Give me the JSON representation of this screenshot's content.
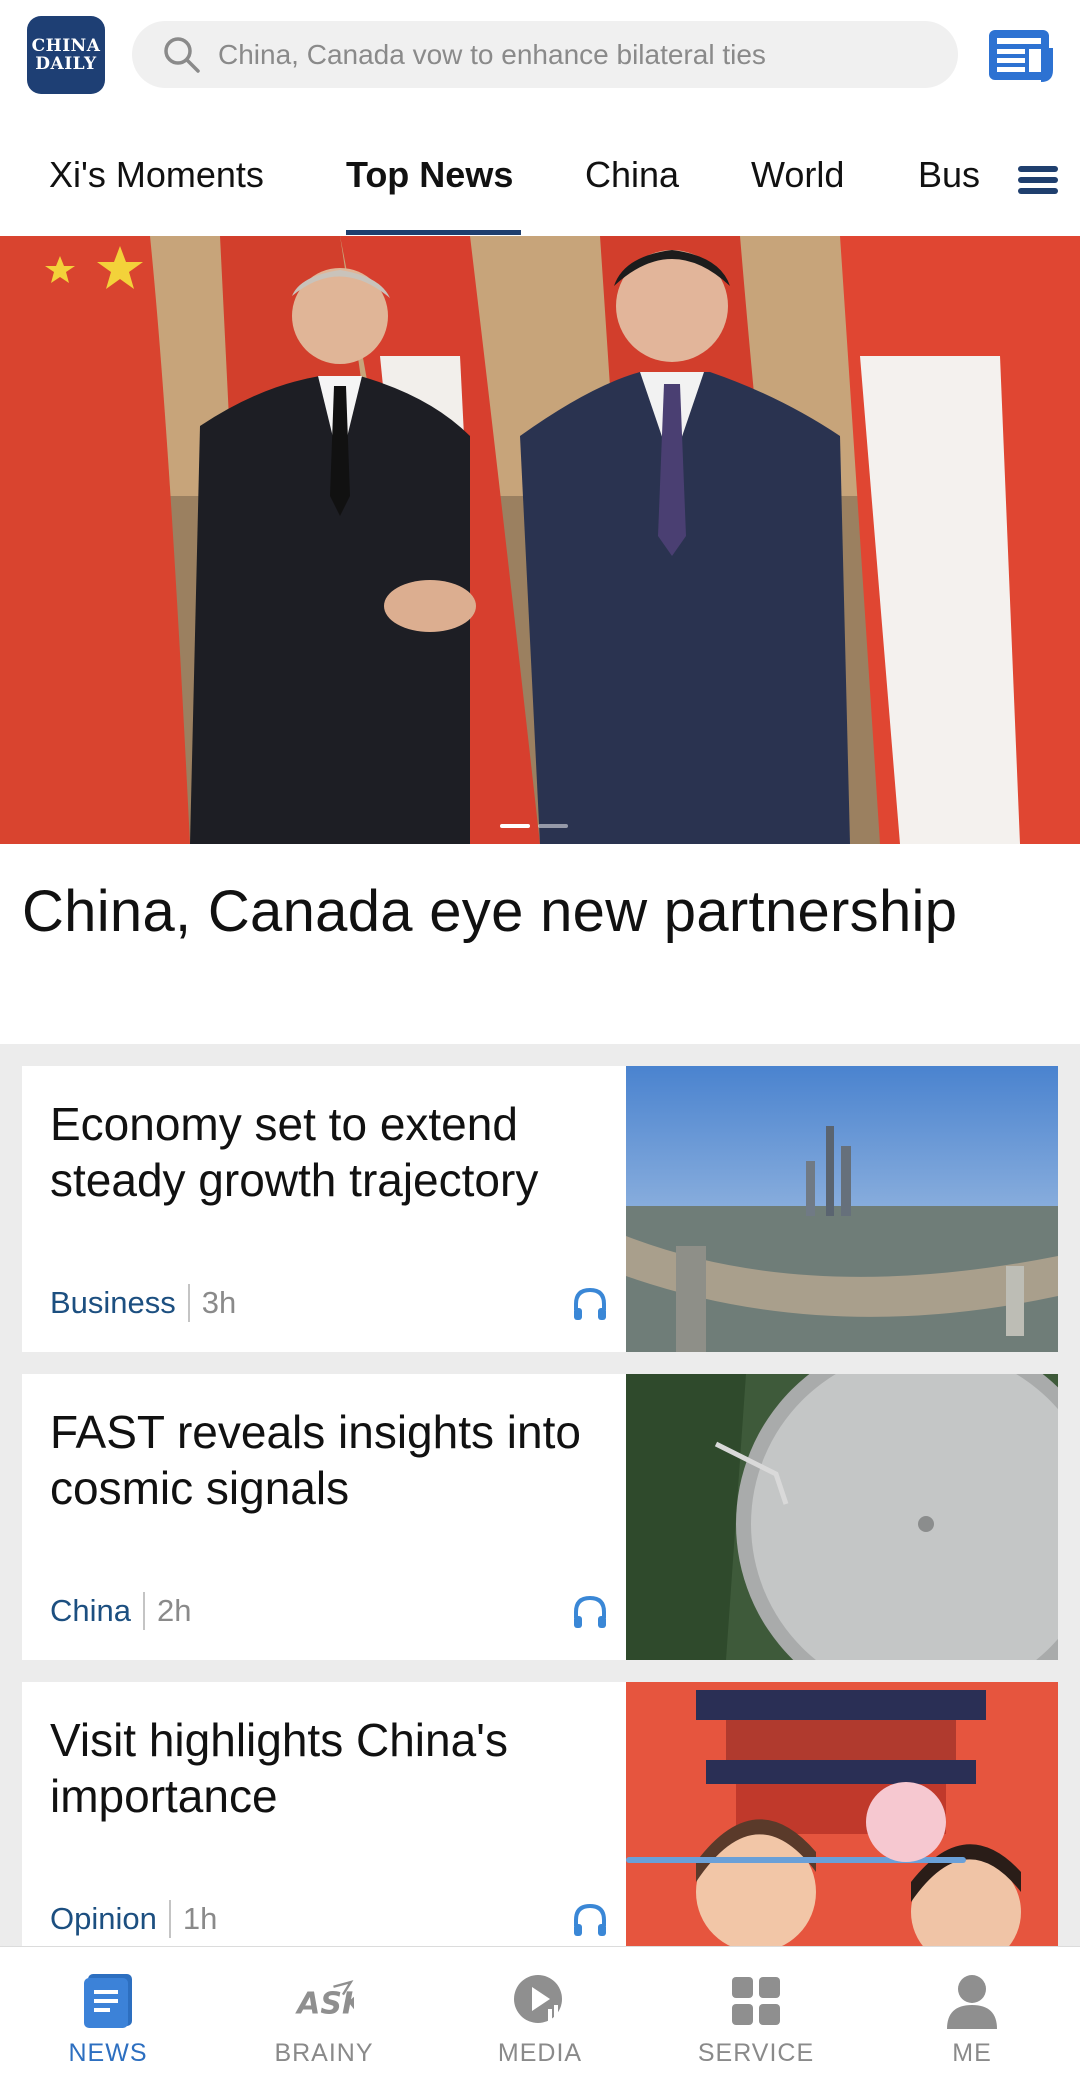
{
  "header": {
    "logo_line1": "CHINA",
    "logo_line2": "DAILY",
    "search_placeholder": "China, Canada vow to enhance bilateral ties",
    "icon_paper": "newspaper-icon"
  },
  "tabs": [
    {
      "label": "Xi's Moments"
    },
    {
      "label": "Top News"
    },
    {
      "label": "China"
    },
    {
      "label": "World"
    },
    {
      "label": "Bus"
    }
  ],
  "active_tab": "Top News",
  "hero": {
    "title": "China, Canada eye new partnership",
    "slide_count": 2,
    "active_slide": 1
  },
  "articles": [
    {
      "title": "Economy set to extend steady growth trajectory",
      "category": "Business",
      "age": "3h"
    },
    {
      "title": "FAST reveals insights into cosmic signals",
      "category": "China",
      "age": "2h"
    },
    {
      "title": "Visit highlights China's importance",
      "category": "Opinion",
      "age": "1h"
    }
  ],
  "bottom_nav": [
    {
      "label": "NEWS",
      "icon": "news-icon",
      "active": true
    },
    {
      "label": "BRAINY",
      "icon": "ask-icon",
      "active": false
    },
    {
      "label": "MEDIA",
      "icon": "play-icon",
      "active": false
    },
    {
      "label": "SERVICE",
      "icon": "grid-icon",
      "active": false
    },
    {
      "label": "ME",
      "icon": "person-icon",
      "active": false
    }
  ],
  "colors": {
    "brand": "#1e3f74",
    "accent_blue": "#2d6fc0",
    "category": "#1c4f80"
  }
}
